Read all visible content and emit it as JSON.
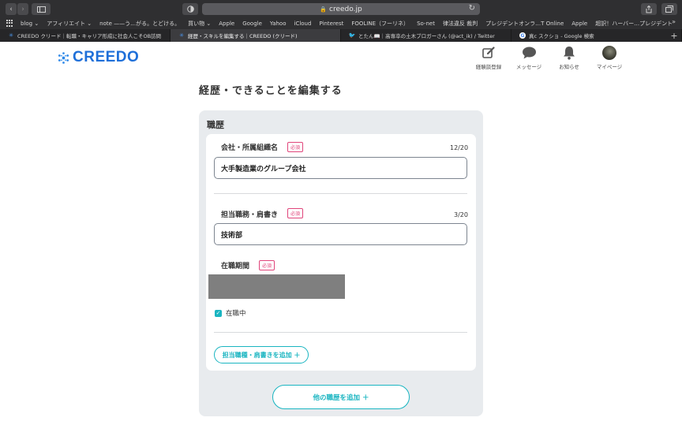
{
  "browser": {
    "url": "creedo.jp",
    "bookmarks": [
      "blog ⌄",
      "アフィリエイト ⌄",
      "note ——う…がる。とどける。",
      "買い物 ⌄",
      "Apple",
      "Google",
      "Yahoo",
      "iCloud",
      "Pinterest",
      "FOOLINE（フーリネ）",
      "So-net",
      "律法違反 裁判",
      "プレジデントオンラ…T Online",
      "Apple",
      "超訳！ハーバー…プレジデント"
    ],
    "tabs": [
      {
        "title": "CREEDO クリード｜転職・キャリア形成に社会人こそOB訪問",
        "active": false
      },
      {
        "title": "経歴・スキルを編集する｜CREEDO (クリード)",
        "active": true
      },
      {
        "title": "とたん📖｜高専卒の土木ブロガーさん (@act_ik) / Twitter",
        "active": false
      },
      {
        "title": "真c スクショ - Google 検索",
        "active": false
      }
    ]
  },
  "header": {
    "logo_text": "CREEDO",
    "brand_color": "#1e6fd9",
    "nav": [
      {
        "label": "経験談登録",
        "icon": "edit-icon"
      },
      {
        "label": "メッセージ",
        "icon": "message-icon"
      },
      {
        "label": "お知らせ",
        "icon": "bell-icon"
      },
      {
        "label": "マイページ",
        "icon": "avatar"
      }
    ]
  },
  "page": {
    "title": "経歴・できることを編集する",
    "section_title": "職歴",
    "company": {
      "label": "会社・所属組織名",
      "required": "必須",
      "counter": "12/20",
      "value": "大手製造業のグループ会社"
    },
    "position": {
      "label": "担当職務・肩書き",
      "required": "必須",
      "counter": "3/20",
      "value": "技術部"
    },
    "period": {
      "label": "在職期間",
      "required": "必須"
    },
    "currently_employed": {
      "label": "在職中",
      "checked": true
    },
    "add_position_button": "担当職種・肩書きを追加 ＋",
    "add_history_button": "他の職歴を追加 ＋",
    "accent_color": "#1ab5c1",
    "required_color": "#e0457b"
  }
}
